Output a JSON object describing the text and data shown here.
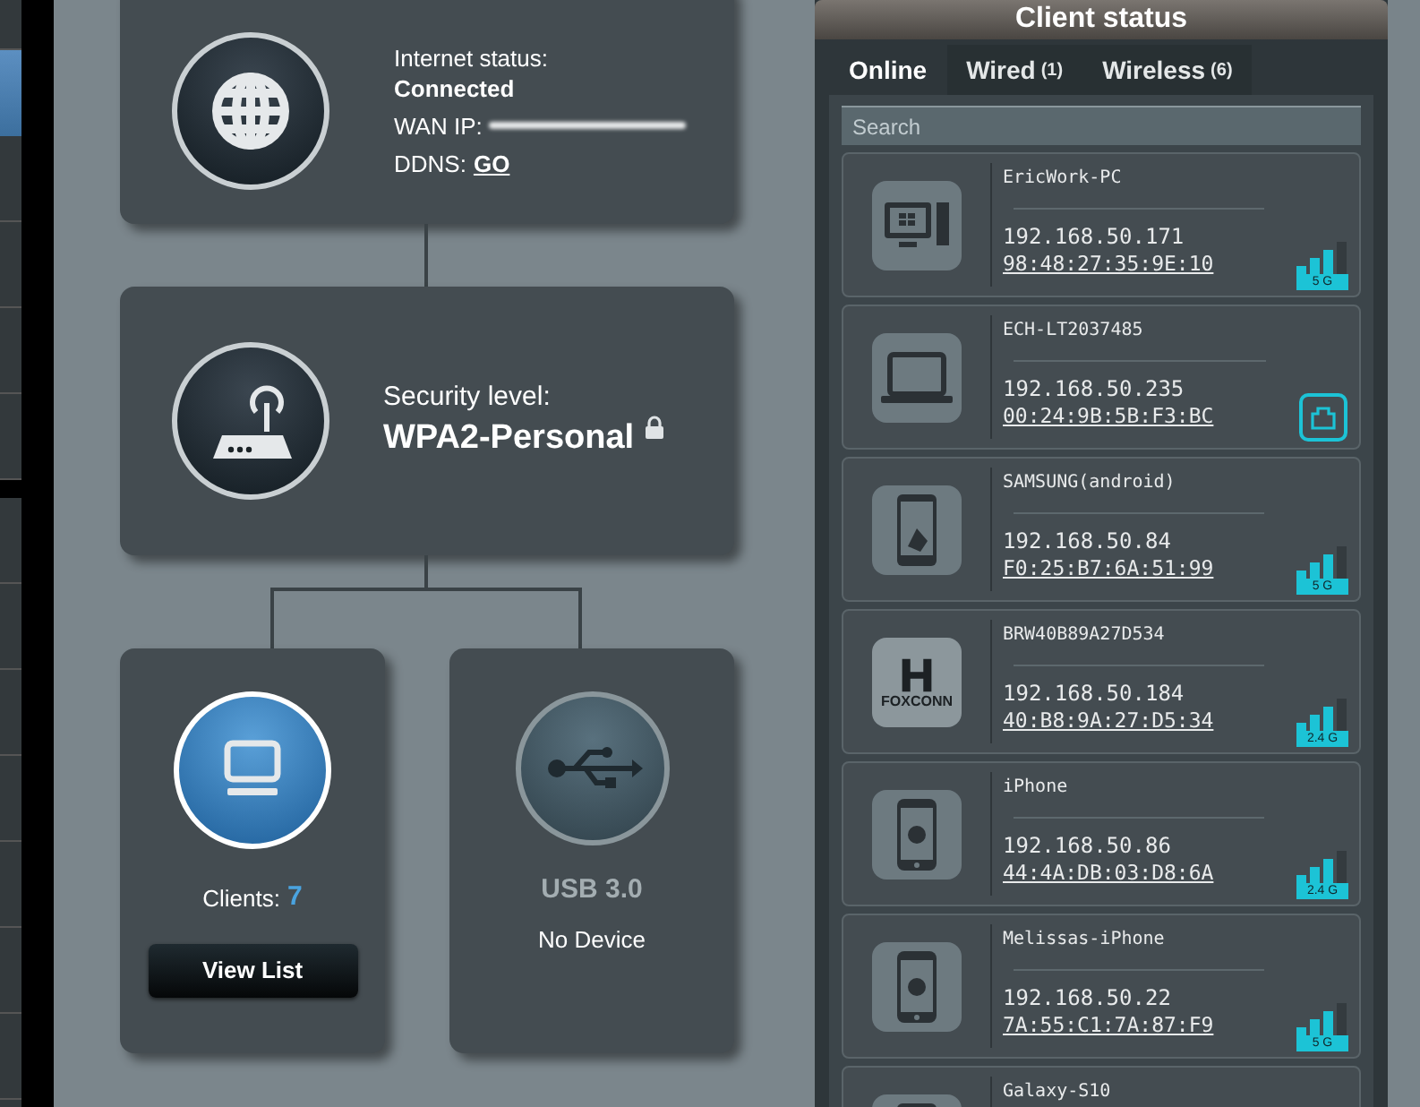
{
  "internet": {
    "status_label": "Internet status:",
    "status": "Connected",
    "wan_label": "WAN IP:",
    "ddns_label": "DDNS:",
    "ddns_link": "GO"
  },
  "security": {
    "label": "Security level:",
    "value": "WPA2-Personal",
    "locked": true
  },
  "clients": {
    "label": "Clients:",
    "count": "7",
    "button": "View List"
  },
  "usb": {
    "title": "USB 3.0",
    "status": "No Device",
    "connected": false
  },
  "client_status": {
    "title": "Client status",
    "tabs": [
      {
        "label": "Online",
        "selected": true
      },
      {
        "label": "Wired",
        "count": "(1)",
        "selected": false
      },
      {
        "label": "Wireless",
        "count": "(6)",
        "selected": false
      }
    ],
    "search": {
      "placeholder": "Search"
    },
    "devices": [
      {
        "name": "EricWork-PC",
        "ip": "192.168.50.171",
        "mac": "98:48:27:35:9E:10",
        "kind": "desktop",
        "band": "5 G"
      },
      {
        "name": "ECH-LT2037485",
        "ip": "192.168.50.235",
        "mac": "00:24:9B:5B:F3:BC",
        "kind": "laptop"
      },
      {
        "name": "SAMSUNG(android)",
        "ip": "192.168.50.84",
        "mac": "F0:25:B7:6A:51:99",
        "kind": "phone",
        "band": "5 G"
      },
      {
        "name": "BRW40B89A27D534",
        "ip": "192.168.50.184",
        "mac": "40:B8:9A:27:D5:34",
        "kind": "logo",
        "logo_text": "FOXCONN",
        "band": "2.4 G"
      },
      {
        "name": "iPhone",
        "ip": "192.168.50.86",
        "mac": "44:4A:DB:03:D8:6A",
        "kind": "iphone",
        "band": "2.4 G"
      },
      {
        "name": "Melissas-iPhone",
        "ip": "192.168.50.22",
        "mac": "7A:55:C1:7A:87:F9",
        "kind": "iphone",
        "band": "5 G"
      },
      {
        "name": "Galaxy-S10",
        "kind": "phone"
      }
    ]
  }
}
